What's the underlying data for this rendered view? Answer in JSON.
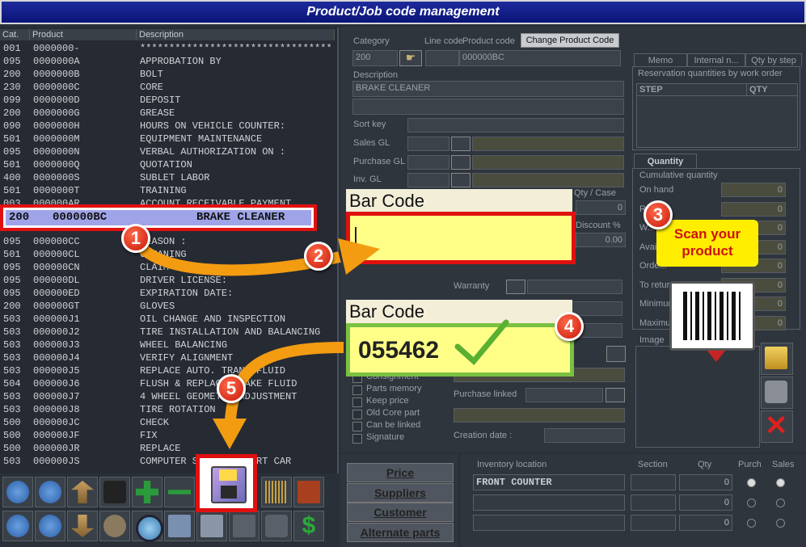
{
  "window": {
    "title": "Product/Job code management"
  },
  "list": {
    "headers": {
      "cat": "Cat.",
      "product": "Product",
      "description": "Description"
    },
    "rows_top": [
      {
        "cat": "001",
        "product": "0000000-",
        "desc": "*********************************"
      },
      {
        "cat": "095",
        "product": "0000000A",
        "desc": "APPROBATION BY"
      },
      {
        "cat": "200",
        "product": "0000000B",
        "desc": "BOLT"
      },
      {
        "cat": "230",
        "product": "0000000C",
        "desc": "CORE"
      },
      {
        "cat": "099",
        "product": "0000000D",
        "desc": "DEPOSIT"
      },
      {
        "cat": "200",
        "product": "0000000G",
        "desc": "GREASE"
      },
      {
        "cat": "090",
        "product": "0000000H",
        "desc": "HOURS ON VEHICLE COUNTER:"
      },
      {
        "cat": "501",
        "product": "0000000M",
        "desc": "EQUIPMENT MAINTENANCE"
      },
      {
        "cat": "095",
        "product": "0000000N",
        "desc": "VERBAL AUTHORIZATION ON :"
      },
      {
        "cat": "501",
        "product": "0000000Q",
        "desc": "QUOTATION"
      },
      {
        "cat": "400",
        "product": "0000000S",
        "desc": "SUBLET LABOR"
      },
      {
        "cat": "501",
        "product": "0000000T",
        "desc": "TRAINING"
      },
      {
        "cat": "003",
        "product": "000000AR",
        "desc": "ACCOUNT RECEIVABLE PAYMENT"
      }
    ],
    "selected": {
      "cat": "200",
      "product": "000000BC",
      "desc": "BRAKE CLEANER"
    },
    "rows_bottom": [
      {
        "cat": "095",
        "product": "000000CC",
        "desc": "REASON :"
      },
      {
        "cat": "501",
        "product": "000000CL",
        "desc": "CLEANING"
      },
      {
        "cat": "095",
        "product": "000000CN",
        "desc": "CLAIM"
      },
      {
        "cat": "095",
        "product": "000000DL",
        "desc": "DRIVER LICENSE:"
      },
      {
        "cat": "095",
        "product": "000000ED",
        "desc": "EXPIRATION DATE:"
      },
      {
        "cat": "200",
        "product": "000000GT",
        "desc": "GLOVES"
      },
      {
        "cat": "503",
        "product": "000000J1",
        "desc": "OIL CHANGE AND INSPECTION"
      },
      {
        "cat": "503",
        "product": "000000J2",
        "desc": "TIRE INSTALLATION AND BALANCING"
      },
      {
        "cat": "503",
        "product": "000000J3",
        "desc": "WHEEL BALANCING"
      },
      {
        "cat": "503",
        "product": "000000J4",
        "desc": "VERIFY ALIGNMENT"
      },
      {
        "cat": "503",
        "product": "000000J5",
        "desc": "REPLACE AUTO. TRANS FLUID"
      },
      {
        "cat": "504",
        "product": "000000J6",
        "desc": "FLUSH & REPLACE BRAKE FLUID"
      },
      {
        "cat": "503",
        "product": "000000J7",
        "desc": "4 WHEEL GEOMETRY ADJUSTMENT"
      },
      {
        "cat": "503",
        "product": "000000J8",
        "desc": "TIRE ROTATION"
      },
      {
        "cat": "500",
        "product": "000000JC",
        "desc": "CHECK"
      },
      {
        "cat": "500",
        "product": "000000JF",
        "desc": "FIX"
      },
      {
        "cat": "500",
        "product": "000000JR",
        "desc": "REPLACE"
      },
      {
        "cat": "503",
        "product": "000000JS",
        "desc": "COMPUTER SCAN - IMPORT CAR"
      }
    ]
  },
  "form": {
    "category_label": "Category",
    "category_value": "200",
    "line_code_label": "Line code",
    "product_code_label": "Product code",
    "product_code_value": "000000BC",
    "change_code_button": "Change Product Code",
    "description_label": "Description",
    "description_value": "BRAKE CLEANER",
    "sort_key_label": "Sort key",
    "sales_gl_label": "Sales GL",
    "purchase_gl_label": "Purchase GL",
    "inv_gl_label": "Inv. GL",
    "qty_case_label": "Qty / Case",
    "qty_case_value": "0",
    "discount_label": "Discount %",
    "discount_value": "0.00",
    "warranty_label": "Warranty",
    "checkboxes": [
      "Consignment",
      "Parts memory",
      "Keep price",
      "Old Core part",
      "Can be linked",
      "Signature"
    ],
    "purchase_linked_label": "Purchase linked",
    "creation_date_label": "Creation date :"
  },
  "tabs": {
    "items": [
      "Memo",
      "Internal n...",
      "Qty by step"
    ],
    "reservation_title": "Reservation quantities by work order",
    "step_header": "STEP",
    "qty_header": "QTY"
  },
  "quantity": {
    "tab": "Quantity",
    "group": "Cumulative quantity",
    "rows": [
      {
        "label": "On hand",
        "value": "0"
      },
      {
        "label": "Re...",
        "value": "0"
      },
      {
        "label": "W...",
        "value": "0"
      },
      {
        "label": "Avai...",
        "value": "0"
      },
      {
        "label": "Orde...",
        "value": "0"
      },
      {
        "label": "To retur...",
        "value": "0"
      },
      {
        "label": "Minimum",
        "value": "0"
      },
      {
        "label": "Maximum",
        "value": "0"
      }
    ],
    "image_label": "Image"
  },
  "bottom_buttons": [
    "Price",
    "Suppliers",
    "Customer",
    "Alternate parts"
  ],
  "inventory": {
    "location_header": "Inventory location",
    "section_header": "Section",
    "qty_header": "Qty",
    "purchase_header": "Purch",
    "sales_header": "Sales",
    "rows": [
      {
        "location": "FRONT COUNTER",
        "qty": "0"
      },
      {
        "location": "",
        "qty": "0"
      },
      {
        "location": "",
        "qty": "0"
      }
    ]
  },
  "annotations": {
    "barcode_label": "Bar Code",
    "scanned_value": "055462",
    "scan_tooltip": "Scan your product",
    "steps": [
      "1",
      "2",
      "3",
      "4",
      "5"
    ]
  },
  "colors": {
    "title_bg": "#0a1478",
    "highlight": "#e01010",
    "yellow": "#ffff88",
    "green_border": "#7ac142",
    "orange_arrow": "#f39c12"
  }
}
